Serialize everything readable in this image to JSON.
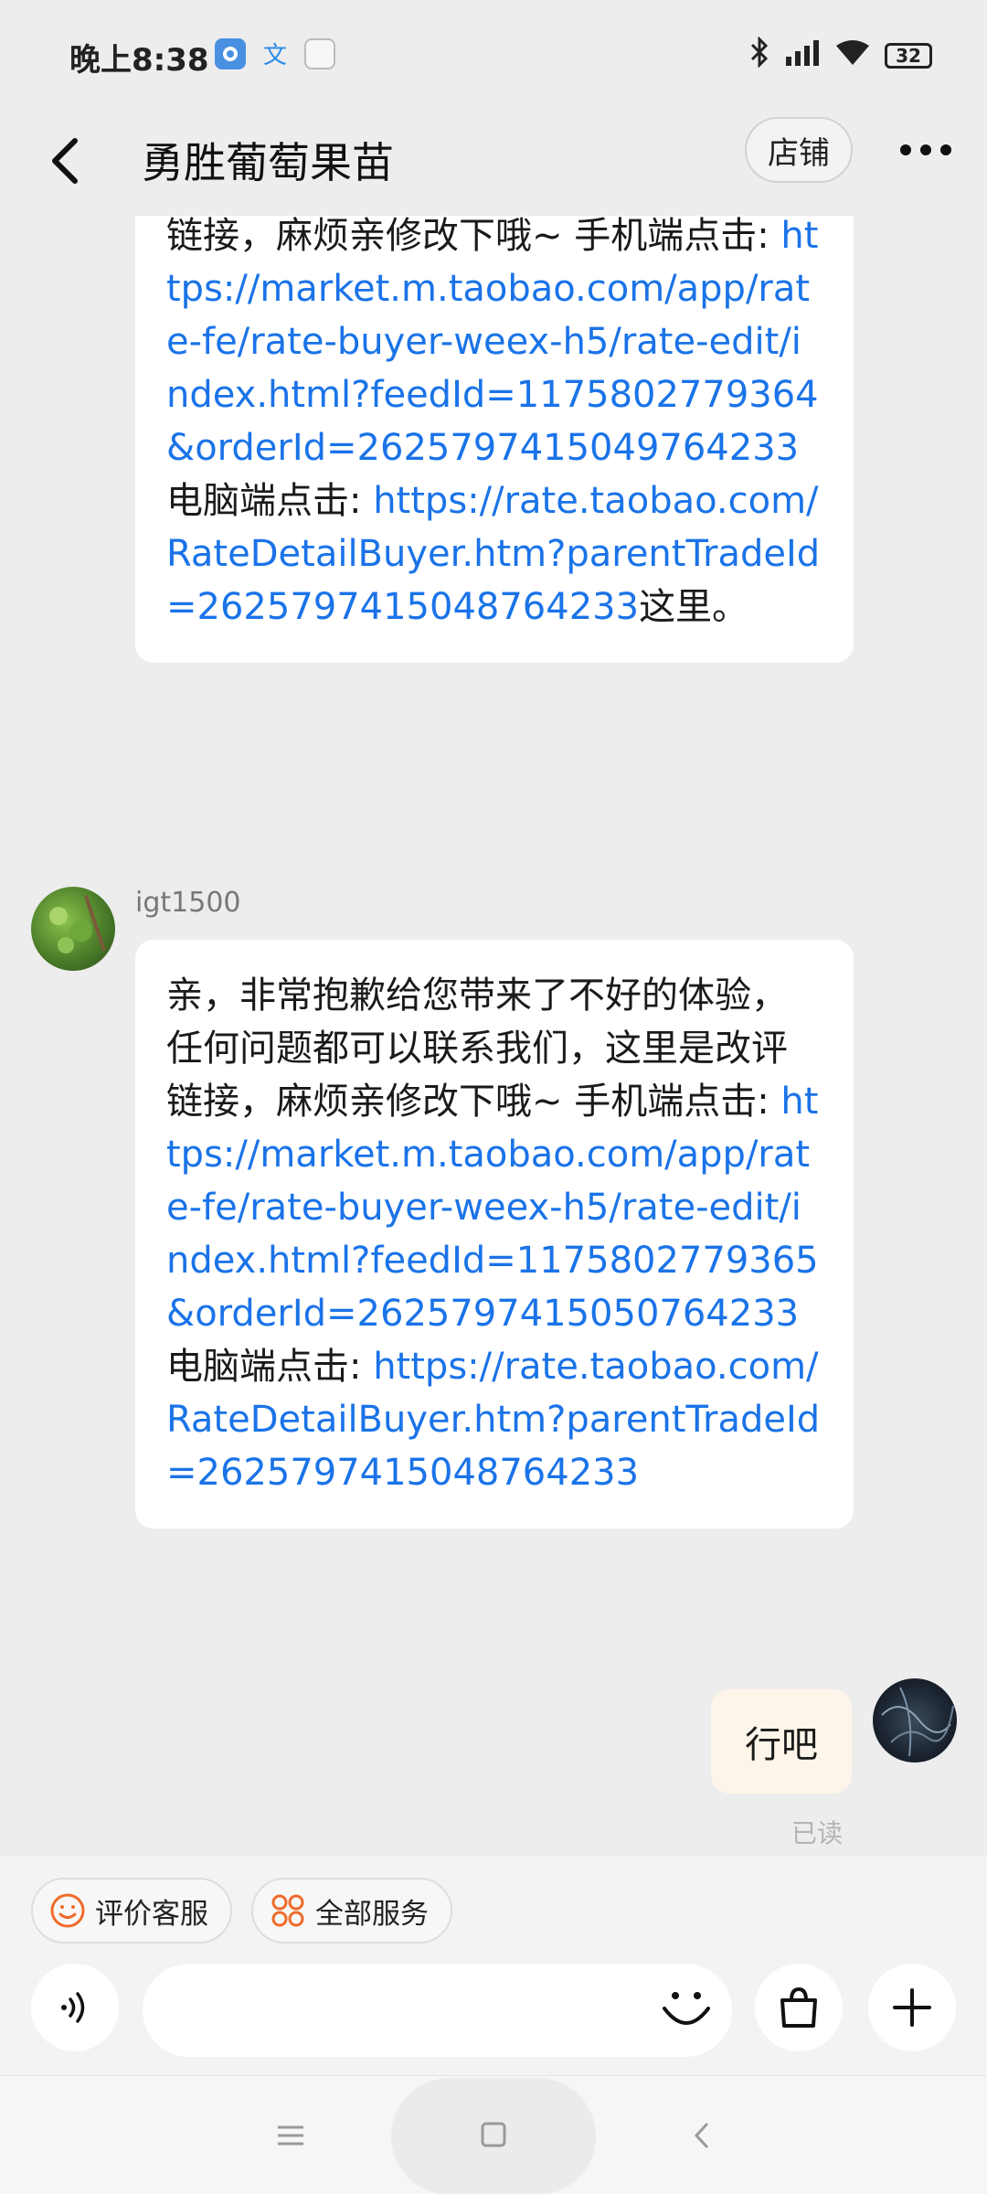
{
  "status_bar": {
    "time": "晚上8:38",
    "battery": "32",
    "icons": [
      "camera-app-icon",
      "translate-app-icon",
      "notification-app-icon",
      "bluetooth-icon",
      "signal-icon",
      "wifi-icon",
      "battery-icon"
    ]
  },
  "header": {
    "title": "勇胜葡萄果苗",
    "shop_label": "店铺"
  },
  "messages": [
    {
      "sender": "",
      "lines": [
        {
          "text": "亲，非常抱歉给您带来了不好的体验，任何问题都可以联系我们，这里是改评链接，麻烦亲修改下哦~ 手机端点击: "
        },
        {
          "link": "https://market.m.taobao.com/app/rate-fe/rate-buyer-weex-h5/rate-edit/index.html?feedId=1175802779364&orderId=2625797415049764233"
        },
        {
          "text": "电脑端点击: "
        },
        {
          "link": "https://rate.taobao.com/RateDetailBuyer.htm?parentTradeId=2625797415048764233"
        },
        {
          "text": "这里。"
        }
      ]
    },
    {
      "sender": "igt1500",
      "lines": [
        {
          "text": "亲，非常抱歉给您带来了不好的体验，任何问题都可以联系我们，这里是改评链接，麻烦亲修改下哦~ 手机端点击: "
        },
        {
          "link": "https://market.m.taobao.com/app/rate-fe/rate-buyer-weex-h5/rate-edit/index.html?feedId=1175802779365&orderId=2625797415050764233"
        },
        {
          "text": "电脑端点击: "
        },
        {
          "link": "https://rate.taobao.com/RateDetailBuyer.htm?parentTradeId=2625797415048764233"
        }
      ]
    }
  ],
  "my_message": {
    "text": "行吧",
    "status": "已读"
  },
  "quick_actions": [
    {
      "label": "评价客服",
      "icon": "smiley-icon"
    },
    {
      "label": "全部服务",
      "icon": "grid-icon"
    }
  ],
  "input": {
    "placeholder": ""
  },
  "colors": {
    "link": "#1a73e8",
    "background": "#ededed",
    "my_bubble": "#fdf5e9",
    "accent": "#f06a2a"
  }
}
